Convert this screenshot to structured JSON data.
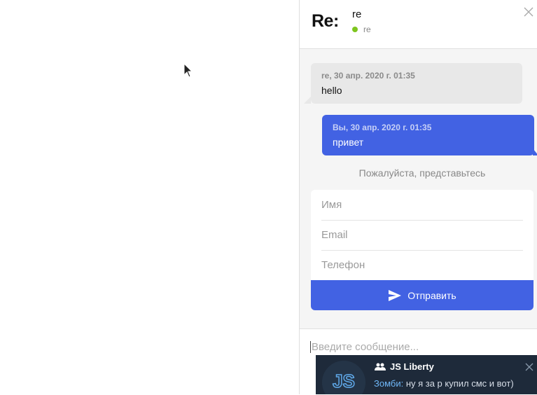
{
  "chat": {
    "logo": "Re:",
    "contact_name": "re",
    "contact_status": "re",
    "messages": [
      {
        "meta": "re, 30 апр. 2020 г. 01:35",
        "text": "hello"
      },
      {
        "meta": "Вы, 30 апр. 2020 г. 01:35",
        "text": "привет"
      }
    ],
    "intro_prompt": "Пожалуйста, представьтесь",
    "form": {
      "name_placeholder": "Имя",
      "email_placeholder": "Email",
      "phone_placeholder": "Телефон",
      "submit_label": "Отправить"
    },
    "composer_placeholder": "Введите сообщение..."
  },
  "notification": {
    "avatar_text": "JS",
    "group": "JS Liberty",
    "sender": "Зомби:",
    "text": " ну я за р купил смс и вот)"
  },
  "colors": {
    "accent": "#4262e3",
    "online": "#7ec51f",
    "toast_bg": "#1e2a3a"
  }
}
